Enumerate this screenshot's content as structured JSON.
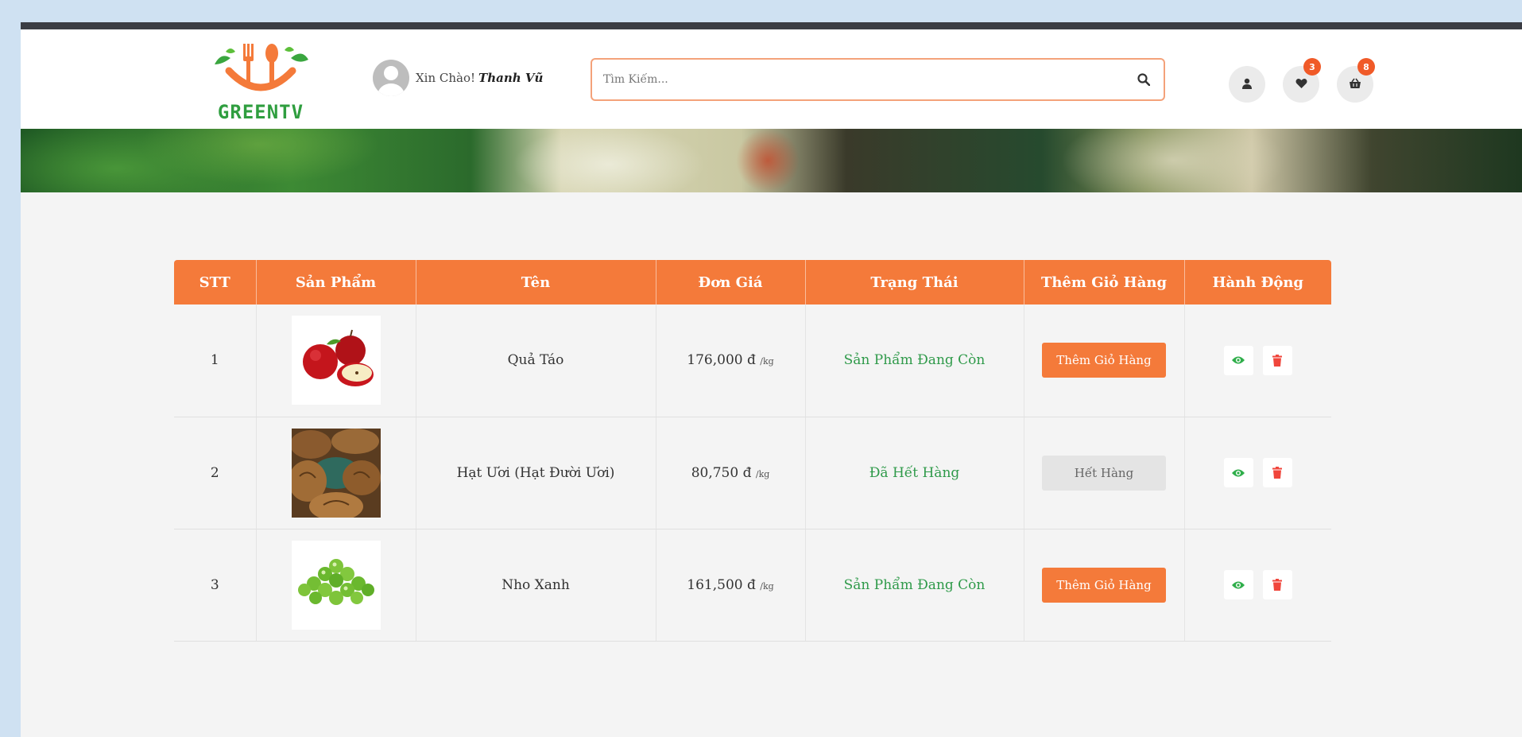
{
  "brand": {
    "logo_text": "GREENTV"
  },
  "header": {
    "greeting": "Xin Chào!",
    "user_name": "Thanh Vũ",
    "search_placeholder": "Tìm Kiếm...",
    "wishlist_count": "3",
    "cart_count": "8",
    "icons": [
      "user-icon",
      "heart-icon",
      "basket-icon",
      "search-icon"
    ]
  },
  "table": {
    "headers": [
      "STT",
      "Sản Phẩm",
      "Tên",
      "Đơn Giá",
      "Trạng Thái",
      "Thêm Giỏ Hàng",
      "Hành Động"
    ],
    "rows": [
      {
        "stt": "1",
        "image": "apple",
        "name": "Quả Táo",
        "price": "176,000 đ",
        "unit": "/kg",
        "status": "Sản Phẩm Đang Còn",
        "cart_label": "Thêm Giỏ Hàng",
        "available": true
      },
      {
        "stt": "2",
        "image": "sapote-seeds",
        "name": "Hạt Ươi (Hạt Đười Ươi)",
        "price": "80,750 đ",
        "unit": "/kg",
        "status": "Đã Hết Hàng",
        "cart_label": "Hết Hàng",
        "available": false
      },
      {
        "stt": "3",
        "image": "green-grapes",
        "name": "Nho Xanh",
        "price": "161,500 đ",
        "unit": "/kg",
        "status": "Sản Phẩm Đang Còn",
        "cart_label": "Thêm Giỏ Hàng",
        "available": true
      }
    ]
  },
  "colors": {
    "accent": "#f47a3a",
    "status_green": "#2f9a4a",
    "badge": "#f05a28",
    "view_icon": "#2fae4a",
    "delete_icon": "#f0463c"
  }
}
